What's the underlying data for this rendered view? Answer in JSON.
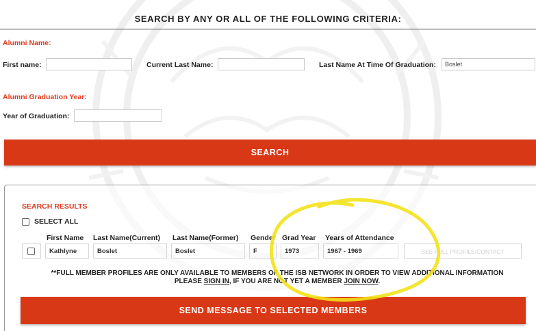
{
  "criteria_title": "SEARCH BY ANY OR ALL OF THE FOLLOWING CRITERIA:",
  "alumni_name": {
    "section_label": "Alumni Name:",
    "first_name_label": "First name:",
    "first_name_value": "",
    "current_last_name_label": "Current Last Name:",
    "current_last_name_value": "",
    "grad_last_name_label": "Last Name At Time Of Graduation:",
    "grad_last_name_value": "Boslet"
  },
  "graduation_year": {
    "section_label": "Alumni Graduation Year:",
    "year_label": "Year of Graduation:",
    "year_value": ""
  },
  "search_button": "SEARCH",
  "results": {
    "section_label": "SEARCH RESULTS",
    "select_all_label": "SELECT ALL",
    "columns": [
      "First Name",
      "Last Name(Current)",
      "Last Name(Former)",
      "Gender",
      "Grad Year",
      "Years of Attendance"
    ],
    "rows": [
      {
        "first_name": "Kathlyne",
        "last_name_current": "Boslet",
        "last_name_former": "Boslet",
        "gender": "F",
        "grad_year": "1973",
        "years_attendance": "1967 - 1969",
        "profile_link": "SEE FULL PROFILE/CONTACT"
      }
    ],
    "notice": {
      "part1": "**FULL MEMBER PROFILES ARE ONLY AVAILABLE TO MEMBERS OF THE ISB NETWORK IN ORDER TO VIEW ADDITIONAL INFORMATION PLEASE ",
      "sign_in": "SIGN IN",
      "part2": ", IF YOU ARE NOT YET A MEMBER ",
      "join_now": "JOIN NOW",
      "part3": "."
    }
  },
  "send_button": "SEND MESSAGE TO SELECTED MEMBERS",
  "colors": {
    "accent": "#d93816",
    "label_red": "#e03a1e",
    "highlight": "#f2e21a"
  }
}
